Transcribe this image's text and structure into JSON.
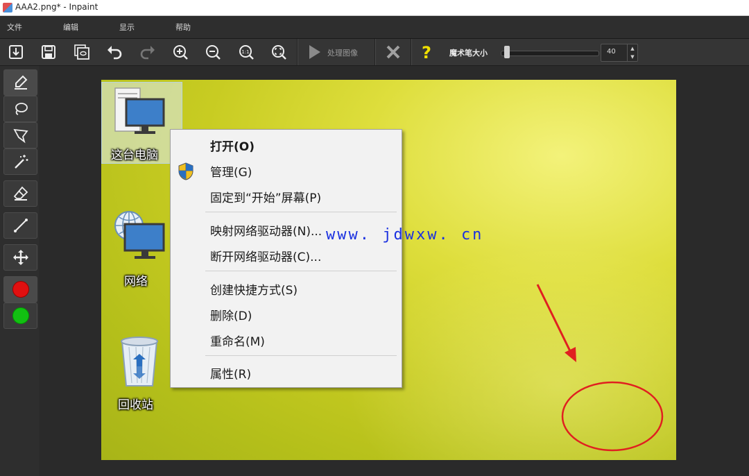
{
  "window": {
    "title": "AAA2.png* - Inpaint"
  },
  "menu": {
    "items": [
      "文件",
      "编辑",
      "显示",
      "帮助"
    ]
  },
  "toolbar": {
    "process_label": "处理图像",
    "brush_size_label": "魔术笔大小",
    "brush_size_value": "40",
    "icons": [
      "open-icon",
      "save-icon",
      "save-as-icon",
      "undo-icon",
      "redo-icon",
      "zoom-in-icon",
      "zoom-out-icon",
      "actual-size-icon",
      "fit-icon",
      "play-icon",
      "close-icon",
      "help-icon"
    ]
  },
  "tools": {
    "items": [
      "marker-icon",
      "lasso-icon",
      "polygon-lasso-icon",
      "magic-wand-icon",
      "eraser-icon",
      "line-icon",
      "move-icon"
    ],
    "colors": {
      "red": "#e01010",
      "green": "#12c012"
    }
  },
  "desktop": {
    "icons": [
      {
        "label": "这台电脑"
      },
      {
        "label": "网络"
      },
      {
        "label": "回收站"
      }
    ]
  },
  "context_menu": {
    "items": [
      {
        "label": "打开(O)"
      },
      {
        "label": "管理(G)"
      },
      {
        "label": "固定到“开始”屏幕(P)"
      },
      {
        "label": "映射网络驱动器(N)..."
      },
      {
        "label": "断开网络驱动器(C)..."
      },
      {
        "label": "创建快捷方式(S)"
      },
      {
        "label": "删除(D)"
      },
      {
        "label": "重命名(M)"
      },
      {
        "label": "属性(R)"
      }
    ]
  },
  "watermark": "www. jdwxw. cn",
  "annotation_color": "#e02020"
}
